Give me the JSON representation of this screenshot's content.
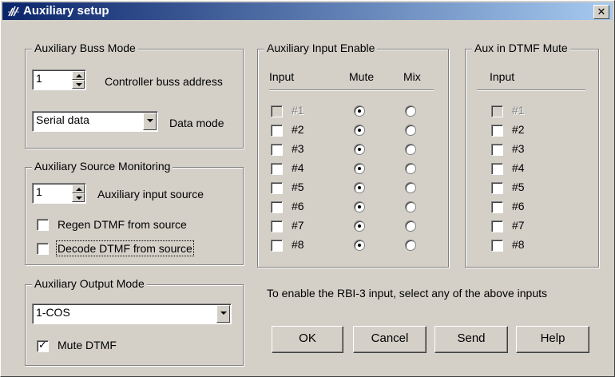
{
  "title": "Auxiliary setup",
  "close_glyph": "✕",
  "buss": {
    "legend": "Auxiliary Buss Mode",
    "address_value": "1",
    "address_label": "Controller buss address",
    "data_mode_value": "Serial data",
    "data_mode_label": "Data mode"
  },
  "source": {
    "legend": "Auxiliary Source Monitoring",
    "input_value": "1",
    "input_label": "Auxiliary input source",
    "regen_label": "Regen DTMF from source",
    "decode_label": "Decode DTMF from source"
  },
  "output": {
    "legend": "Auxiliary Output Mode",
    "mode_value": "1-COS",
    "mute_label": "Mute DTMF",
    "mute_checked": true
  },
  "enable": {
    "legend": "Auxiliary Input Enable",
    "col_input": "Input",
    "col_mute": "Mute",
    "col_mix": "Mix",
    "rows": [
      {
        "label": "#1",
        "enabled": false,
        "checked": false,
        "mute": true
      },
      {
        "label": "#2",
        "enabled": true,
        "checked": false,
        "mute": true
      },
      {
        "label": "#3",
        "enabled": true,
        "checked": false,
        "mute": true
      },
      {
        "label": "#4",
        "enabled": true,
        "checked": false,
        "mute": true
      },
      {
        "label": "#5",
        "enabled": true,
        "checked": false,
        "mute": true
      },
      {
        "label": "#6",
        "enabled": true,
        "checked": false,
        "mute": true
      },
      {
        "label": "#7",
        "enabled": true,
        "checked": false,
        "mute": true
      },
      {
        "label": "#8",
        "enabled": true,
        "checked": false,
        "mute": true
      }
    ]
  },
  "dtmf_mute": {
    "legend": "Aux in DTMF Mute",
    "col_input": "Input",
    "rows": [
      {
        "label": "#1",
        "enabled": false,
        "checked": false
      },
      {
        "label": "#2",
        "enabled": true,
        "checked": false
      },
      {
        "label": "#3",
        "enabled": true,
        "checked": false
      },
      {
        "label": "#4",
        "enabled": true,
        "checked": false
      },
      {
        "label": "#5",
        "enabled": true,
        "checked": false
      },
      {
        "label": "#6",
        "enabled": true,
        "checked": false
      },
      {
        "label": "#7",
        "enabled": true,
        "checked": false
      },
      {
        "label": "#8",
        "enabled": true,
        "checked": false
      }
    ]
  },
  "note": "To enable the RBI-3 input, select any of the above inputs",
  "buttons": {
    "ok": "OK",
    "cancel": "Cancel",
    "send": "Send",
    "help": "Help"
  }
}
